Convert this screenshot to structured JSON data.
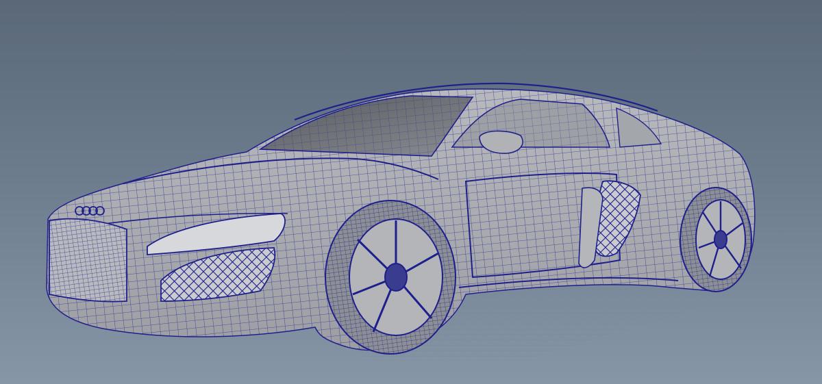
{
  "viewport": {
    "background_top": "#5a6878",
    "background_bottom": "#8696a7",
    "wire_color": "#1f1f8c",
    "surface_color": "#a9abaf",
    "glass_color": "#6f7277",
    "grid_color": "#7c8896"
  },
  "model": {
    "type": "car",
    "display_mode": "wireframe-on-shaded"
  }
}
